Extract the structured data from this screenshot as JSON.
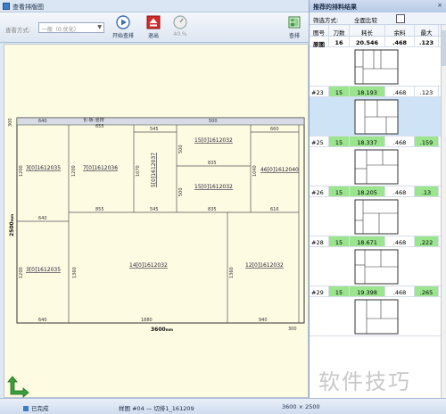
{
  "window": {
    "title": "查看排版图"
  },
  "toolbar": {
    "mode_label": "查看方式:",
    "mode_value": "一般（0.优化）",
    "buttons": [
      {
        "label": "开始查排",
        "icon": "play-icon"
      },
      {
        "label": "退出",
        "icon": "exit-icon"
      },
      {
        "label": "40.%",
        "icon": "gauge-icon"
      },
      {
        "label": "查排",
        "icon": "layout-icon"
      }
    ]
  },
  "layout": {
    "board_height": "2500",
    "board_height_unit": "mm",
    "board_width": "3600",
    "board_width_unit": "mm",
    "trim_top": "300",
    "trim_right": "300",
    "sheet_label": "长-板-竖排",
    "sheet_label_2": "655",
    "parts": [
      {
        "label": "3[0]1612035",
        "w": "640",
        "h": "1200"
      },
      {
        "label": "3[0]1612035",
        "w": "640",
        "h": "1200"
      },
      {
        "label": "7[0]1612036",
        "w": "855",
        "h": "1200"
      },
      {
        "label": "5[0]1612037",
        "w": "545",
        "h": "1070"
      },
      {
        "label": "15[0]1612032",
        "w": "835",
        "h": "500"
      },
      {
        "label": "15[0]1612032",
        "w": "835",
        "h": "500"
      },
      {
        "label": "46[0]1612040",
        "w": "616",
        "h": "1040"
      },
      {
        "label": "14[0]1612032",
        "w": "1880",
        "h": "1360"
      },
      {
        "label": "12[0]1612032",
        "w": "940",
        "h": "1360"
      }
    ],
    "dims": {
      "top1": "640",
      "top3": "545",
      "top4": "500",
      "top5": "660",
      "mid1": "835",
      "mid2": "835"
    }
  },
  "results": {
    "title": "推荐的排料结果",
    "filter_label": "筛选方式:",
    "filter_value": "全面比较",
    "columns": [
      "图号",
      "刀数",
      "耗长",
      "余料",
      "最大"
    ],
    "summary": [
      "原图",
      "16",
      "20.546",
      ".468",
      ".123"
    ],
    "rows": [
      {
        "no": "#23",
        "knife": "15",
        "len": "18.193",
        "rem": ".468",
        "max": ".123"
      },
      {
        "no": "#25",
        "knife": "15",
        "len": "18.337",
        "rem": ".468",
        "max": ".159"
      },
      {
        "no": "#26",
        "knife": "15",
        "len": "18.205",
        "rem": ".468",
        "max": ".13"
      },
      {
        "no": "#28",
        "knife": "15",
        "len": "18.671",
        "rem": ".468",
        "max": ".222"
      },
      {
        "no": "#29",
        "knife": "15",
        "len": "19.398",
        "rem": ".468",
        "max": ".265"
      }
    ]
  },
  "status": {
    "left": "已完成",
    "middle": "样图 #04 — 切排1_161209",
    "right": "3600 × 2500"
  },
  "watermark": "软件技巧",
  "colors": {
    "canvas": "#fefbe3",
    "highlight": "#9be58f",
    "selected": "#cfe3f7"
  }
}
